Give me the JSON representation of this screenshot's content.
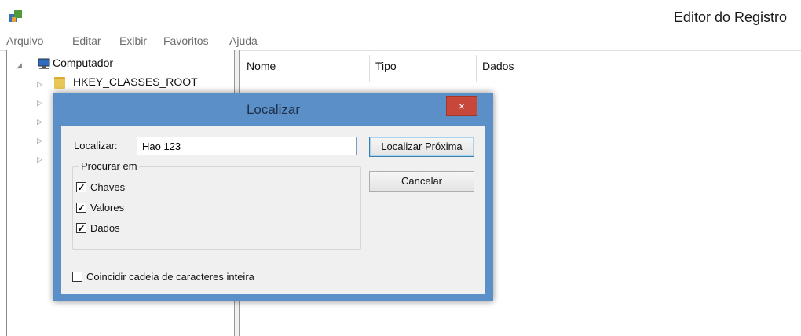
{
  "window": {
    "title": "Editor do Registro"
  },
  "menu": [
    "Arquivo",
    "Editar",
    "Exibir",
    "Favoritos",
    "Ajuda"
  ],
  "tree": {
    "root": "Computador",
    "first_child": "HKEY_CLASSES_ROOT"
  },
  "columns": [
    "Nome",
    "Tipo",
    "Dados"
  ],
  "dialog": {
    "title": "Localizar",
    "close_glyph": "×",
    "find_label": "Localizar:",
    "find_value": "Hao 123",
    "find_next_label": "Localizar Próxima",
    "cancel_label": "Cancelar",
    "group_title": "Procurar em",
    "options": [
      {
        "label": "Chaves",
        "checked": true
      },
      {
        "label": "Valores",
        "checked": true
      },
      {
        "label": "Dados",
        "checked": true
      }
    ],
    "whole_string": {
      "label": "Coincidir cadeia de caracteres inteira",
      "checked": false
    }
  },
  "colors": {
    "dialog_frame": "#5b8fc7",
    "close_button": "#c7473b",
    "folder": "#e8c657"
  },
  "icons": [
    "registry-editor-icon",
    "computer-icon",
    "folder-icon",
    "close-icon",
    "checkmark-icon"
  ]
}
